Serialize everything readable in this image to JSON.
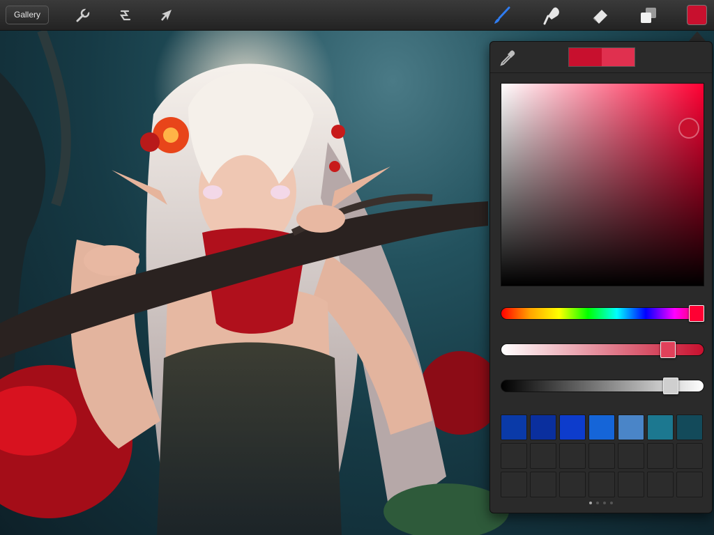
{
  "toolbar": {
    "gallery_label": "Gallery",
    "tools": [
      {
        "name": "actions",
        "icon": "wrench-icon"
      },
      {
        "name": "adjustments",
        "icon": "magic-wand-icon"
      },
      {
        "name": "transform",
        "icon": "cursor-arrow-icon"
      },
      {
        "name": "brush",
        "icon": "brush-icon",
        "active": true
      },
      {
        "name": "smudge",
        "icon": "smudge-finger-icon"
      },
      {
        "name": "eraser",
        "icon": "eraser-icon"
      },
      {
        "name": "layers",
        "icon": "layers-icon"
      }
    ],
    "current_color": "#c8102e"
  },
  "color_panel": {
    "current_color": "#c8102e",
    "previous_color": "#e0304f",
    "hue_color": "#ff0033",
    "hue": 0.93,
    "saturation": 0.92,
    "brightness": 0.9,
    "opacity": 0.82,
    "palette": [
      "#0a3aa8",
      "#0a2f9e",
      "#0d3ccc",
      "#1565d8",
      "#4a85c8",
      "#1c7890",
      "#134a5a",
      "#2c2c2c",
      "#2c2c2c",
      "#2c2c2c",
      "#2c2c2c",
      "#2c2c2c",
      "#2c2c2c",
      "#2c2c2c",
      "#2c2c2c",
      "#2c2c2c",
      "#2c2c2c",
      "#2c2c2c",
      "#2c2c2c",
      "#2c2c2c",
      "#2c2c2c"
    ],
    "pages": 4,
    "active_page": 0
  }
}
